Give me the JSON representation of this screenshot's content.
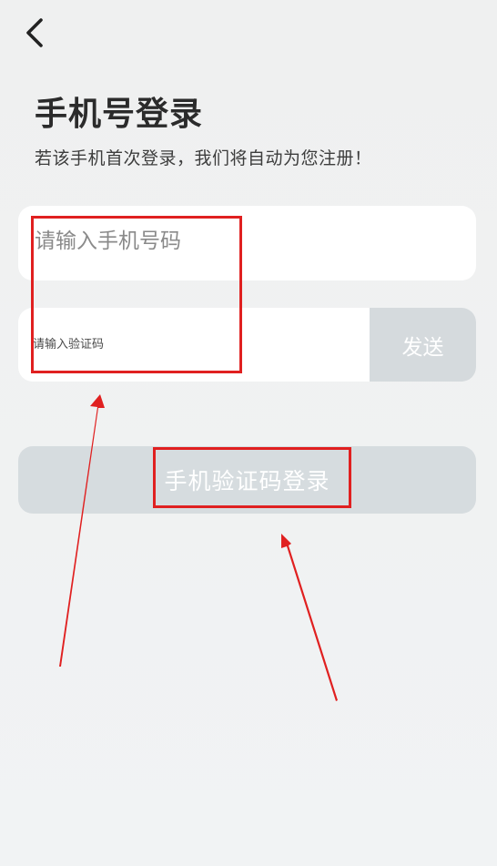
{
  "header": {
    "back_icon": "chevron-left-icon"
  },
  "title": "手机号登录",
  "subtitle": "若该手机首次登录，我们将自动为您注册！",
  "phone": {
    "placeholder": "请输入手机号码",
    "value": ""
  },
  "code": {
    "placeholder": "请输入验证码",
    "value": "",
    "send_label": "发送"
  },
  "login_button_label": "手机验证码登录",
  "colors": {
    "annotation": "#e02020",
    "button_disabled": "#d6dcdf",
    "background": "#f0f2f3"
  }
}
